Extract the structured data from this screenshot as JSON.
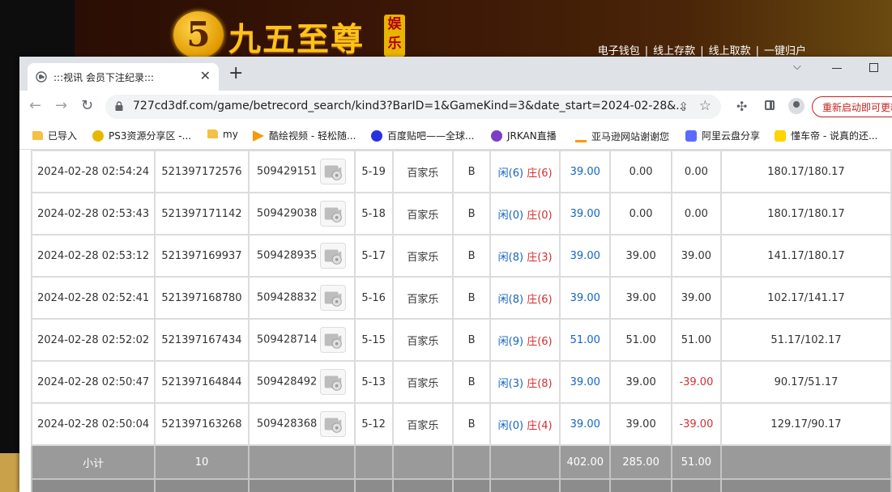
{
  "site": {
    "logo_digit": "5",
    "logo_text": "九五至尊",
    "logo_badge": "娱乐",
    "top_links": [
      "电子钱包",
      "线上存款",
      "线上取款",
      "一键归户"
    ]
  },
  "browser": {
    "tab_title": ":::视讯 会员下注纪录:::",
    "url": "727cd3df.com/game/betrecord_search/kind3?BarID=1&GameKind=3&date_start=2024-02-28&...",
    "restart_label": "重新启动即可更新",
    "bookmarks": [
      {
        "icon": "folder-icon",
        "label": "已导入"
      },
      {
        "icon": "ps3-icon",
        "label": "PS3资源分享区 -..."
      },
      {
        "icon": "folder-icon",
        "label": "my"
      },
      {
        "icon": "kuai-icon",
        "label": "酷绘视频 - 轻松随..."
      },
      {
        "icon": "baidu-paw-icon",
        "label": "百度贴吧——全球..."
      },
      {
        "icon": "jrkan-icon",
        "label": "JRKAN直播"
      },
      {
        "icon": "amazon-icon",
        "label": "亚马逊网站谢谢您"
      },
      {
        "icon": "aliyun-icon",
        "label": "阿里云盘分享"
      },
      {
        "icon": "dongchedi-icon",
        "label": "懂车帝 - 说真的还..."
      }
    ]
  },
  "table": {
    "rows": [
      {
        "time": "2024-02-28 02:54:24",
        "order_no": "521397172576",
        "round_no": "509429151",
        "shoe": "5-19",
        "game": "百家乐",
        "bet": "B",
        "xian_label": "闲",
        "xian": "(6)",
        "zhuang_label": "庄",
        "zhuang": "(6)",
        "amount": "39.00",
        "valid": "0.00",
        "result": "0.00",
        "result_negative": false,
        "balance": "180.17/180.17"
      },
      {
        "time": "2024-02-28 02:53:43",
        "order_no": "521397171142",
        "round_no": "509429038",
        "shoe": "5-18",
        "game": "百家乐",
        "bet": "B",
        "xian_label": "闲",
        "xian": "(0)",
        "zhuang_label": "庄",
        "zhuang": "(0)",
        "amount": "39.00",
        "valid": "0.00",
        "result": "0.00",
        "result_negative": false,
        "balance": "180.17/180.17"
      },
      {
        "time": "2024-02-28 02:53:12",
        "order_no": "521397169937",
        "round_no": "509428935",
        "shoe": "5-17",
        "game": "百家乐",
        "bet": "B",
        "xian_label": "闲",
        "xian": "(8)",
        "zhuang_label": "庄",
        "zhuang": "(3)",
        "amount": "39.00",
        "valid": "39.00",
        "result": "39.00",
        "result_negative": false,
        "balance": "141.17/180.17"
      },
      {
        "time": "2024-02-28 02:52:41",
        "order_no": "521397168780",
        "round_no": "509428832",
        "shoe": "5-16",
        "game": "百家乐",
        "bet": "B",
        "xian_label": "闲",
        "xian": "(8)",
        "zhuang_label": "庄",
        "zhuang": "(6)",
        "amount": "39.00",
        "valid": "39.00",
        "result": "39.00",
        "result_negative": false,
        "balance": "102.17/141.17"
      },
      {
        "time": "2024-02-28 02:52:02",
        "order_no": "521397167434",
        "round_no": "509428714",
        "shoe": "5-15",
        "game": "百家乐",
        "bet": "B",
        "xian_label": "闲",
        "xian": "(9)",
        "zhuang_label": "庄",
        "zhuang": "(6)",
        "amount": "51.00",
        "valid": "51.00",
        "result": "51.00",
        "result_negative": false,
        "balance": "51.17/102.17"
      },
      {
        "time": "2024-02-28 02:50:47",
        "order_no": "521397164844",
        "round_no": "509428492",
        "shoe": "5-13",
        "game": "百家乐",
        "bet": "B",
        "xian_label": "闲",
        "xian": "(3)",
        "zhuang_label": "庄",
        "zhuang": "(8)",
        "amount": "39.00",
        "valid": "39.00",
        "result": "-39.00",
        "result_negative": true,
        "balance": "90.17/51.17"
      },
      {
        "time": "2024-02-28 02:50:04",
        "order_no": "521397163268",
        "round_no": "509428368",
        "shoe": "5-12",
        "game": "百家乐",
        "bet": "B",
        "xian_label": "闲",
        "xian": "(0)",
        "zhuang_label": "庄",
        "zhuang": "(4)",
        "amount": "39.00",
        "valid": "39.00",
        "result": "-39.00",
        "result_negative": true,
        "balance": "129.17/90.17"
      }
    ],
    "subtotal": {
      "label": "小计",
      "count": "10",
      "amount": "402.00",
      "valid": "285.00",
      "result": "51.00"
    }
  },
  "colors": {
    "link_blue": "#1565c0",
    "loss_red": "#d32f2f",
    "subtotal_bg": "#9a9a9a"
  }
}
